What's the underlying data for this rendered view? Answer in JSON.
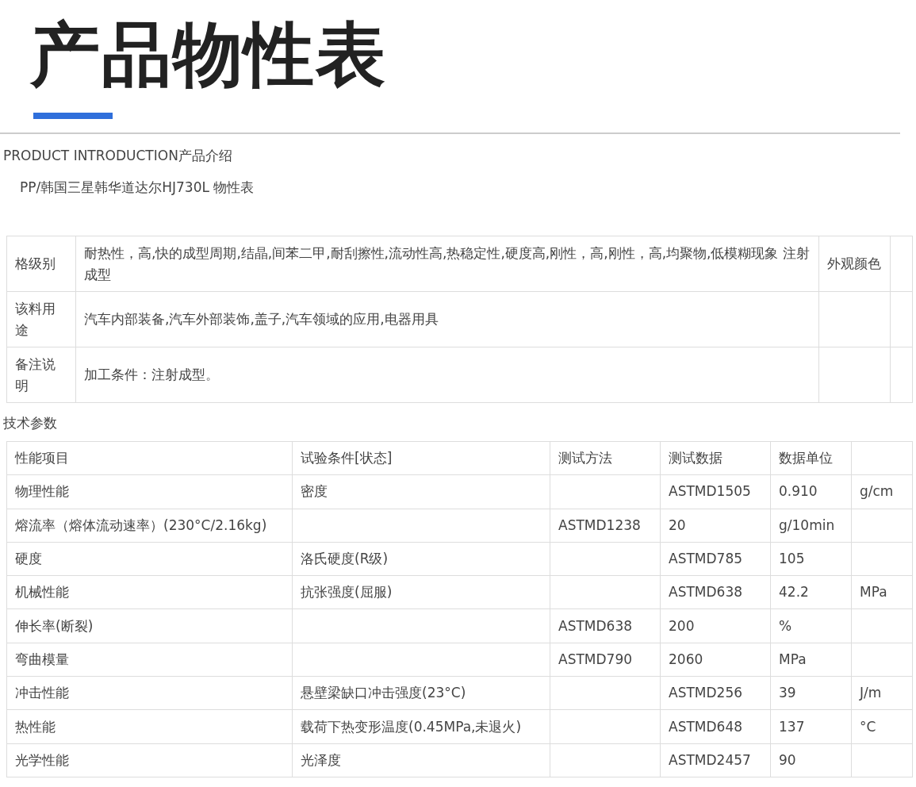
{
  "title": "产品物性表",
  "intro_heading": "PRODUCT INTRODUCTION产品介绍",
  "product_name": "PP/韩国三星韩华道达尔HJ730L 物性表",
  "info_table": {
    "rows": [
      {
        "label": "格级别",
        "value": "耐热性，高,快的成型周期,结晶,间苯二甲,耐刮擦性,流动性高,热稳定性,硬度高,刚性，高,刚性，高,均聚物,低模糊现象 注射成型",
        "column_3": "外观颜色"
      },
      {
        "label": "该料用途",
        "value": "汽车内部装备,汽车外部装饰,盖子,汽车领域的应用,电器用具"
      },
      {
        "label": "备注说明",
        "value": "加工条件：注射成型。"
      }
    ]
  },
  "tech_heading": "技术参数",
  "tech_table": {
    "columns": [
      "性能项目",
      "试验条件[状态]",
      "测试方法",
      "测试数据",
      "数据单位",
      null
    ],
    "rows": [
      [
        "物理性能",
        "密度",
        null,
        "ASTMD1505",
        "0.910",
        "g/cm"
      ],
      [
        "熔流率（熔体流动速率）(230°C/2.16kg)",
        null,
        "ASTMD1238",
        "20",
        "g/10min",
        null
      ],
      [
        "硬度",
        "洛氏硬度(R级)",
        null,
        "ASTMD785",
        "105",
        null
      ],
      [
        "机械性能",
        "抗张强度(屈服)",
        null,
        "ASTMD638",
        "42.2",
        "MPa"
      ],
      [
        "伸长率(断裂)",
        null,
        "ASTMD638",
        "200",
        "%",
        null
      ],
      [
        "弯曲模量",
        null,
        "ASTMD790",
        "2060",
        "MPa",
        null
      ],
      [
        "冲击性能",
        "悬壁梁缺口冲击强度(23°C)",
        null,
        "ASTMD256",
        "39",
        "J/m"
      ],
      [
        "热性能",
        "载荷下热变形温度(0.45MPa,未退火)",
        null,
        "ASTMD648",
        "137",
        "°C"
      ],
      [
        "光学性能",
        "光泽度",
        null,
        "ASTMD2457",
        "90",
        null
      ]
    ]
  }
}
